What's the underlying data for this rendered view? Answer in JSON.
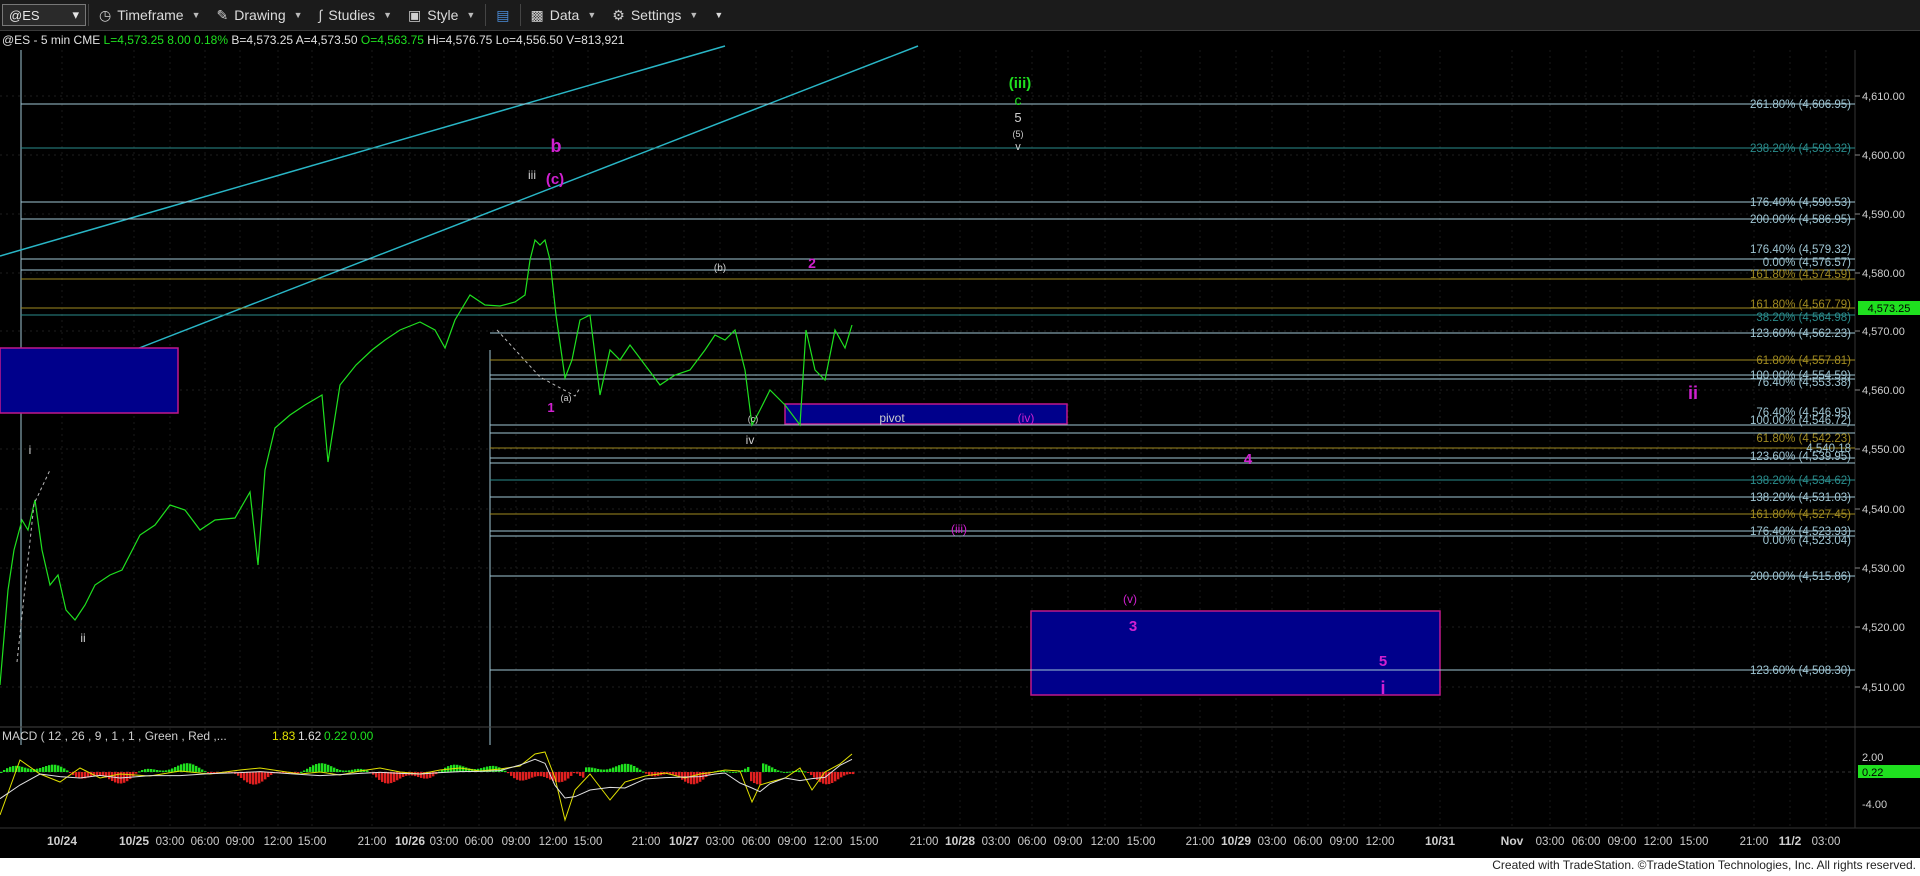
{
  "toolbar": {
    "symbol": "@ES",
    "timeframe": "Timeframe",
    "drawing": "Drawing",
    "studies": "Studies",
    "style": "Style",
    "data": "Data",
    "settings": "Settings"
  },
  "header": {
    "symbol_line": "@ES - 5 min  CME",
    "last": "L=4,573.25",
    "change": "8.00",
    "pct": "0.18%",
    "bid": "B=4,573.25",
    "ask": "A=4,573.50",
    "open": "O=4,563.75",
    "high": "Hi=4,576.75",
    "low": "Lo=4,556.50",
    "volume": "V=813,921"
  },
  "price_axis": {
    "ticks": [
      "4,610.00",
      "4,600.00",
      "4,590.00",
      "4,580.00",
      "4,570.00",
      "4,560.00",
      "4,550.00",
      "4,540.00",
      "4,530.00",
      "4,520.00",
      "4,510.00"
    ],
    "current": "4,573.25"
  },
  "time_axis": {
    "labels": [
      "10/24",
      "10/25",
      "03:00",
      "06:00",
      "09:00",
      "12:00",
      "15:00",
      "21:00",
      "10/26",
      "03:00",
      "06:00",
      "09:00",
      "12:00",
      "15:00",
      "21:00",
      "10/27",
      "03:00",
      "06:00",
      "09:00",
      "12:00",
      "15:00",
      "21:00",
      "10/28",
      "03:00",
      "06:00",
      "09:00",
      "12:00",
      "15:00",
      "21:00",
      "10/29",
      "03:00",
      "06:00",
      "09:00",
      "12:00",
      "10/31",
      "Nov",
      "03:00",
      "06:00",
      "09:00",
      "12:00",
      "15:00",
      "21:00",
      "11/2",
      "03:00"
    ]
  },
  "fib_levels": [
    {
      "label": "261.80% (4,606.95)",
      "color": "#9fc6d4"
    },
    {
      "label": "238.20% (4,599.32)",
      "color": "#2a8c8c"
    },
    {
      "label": "176.40% (4,590.53)",
      "color": "#9fc6d4"
    },
    {
      "label": "200.00% (4,586.95)",
      "color": "#9fc6d4"
    },
    {
      "label": "176.40% (4,579.32)",
      "color": "#9fc6d4"
    },
    {
      "label": "0.00% (4,576.57)",
      "color": "#9fc6d4"
    },
    {
      "label": "161.80% (4,574.59)",
      "color": "#a08a20"
    },
    {
      "label": "161.80% (4,567.79)",
      "color": "#a08a20"
    },
    {
      "label": "38.20% (4,564.98)",
      "color": "#2a8c8c"
    },
    {
      "label": "123.60% (4,562.23)",
      "color": "#9fc6d4"
    },
    {
      "label": "61.80% (4,557.81)",
      "color": "#a08a20"
    },
    {
      "label": "100.00% (4,554.59)",
      "color": "#9fc6d4"
    },
    {
      "label": "76.40% (4,553.38)",
      "color": "#9fc6d4"
    },
    {
      "label": "76.40% (4,546.95)",
      "color": "#9fc6d4"
    },
    {
      "label": "100.00% (4,546.72)",
      "color": "#9fc6d4"
    },
    {
      "label": "61.80% (4,542.23)",
      "color": "#a08a20"
    },
    {
      "label": "4,540.18",
      "color": "#9fc6d4"
    },
    {
      "label": "123.60% (4,539.95)",
      "color": "#9fc6d4"
    },
    {
      "label": "138.20% (4,534.62)",
      "color": "#2a8c8c"
    },
    {
      "label": "138.20% (4,531.03)",
      "color": "#9fc6d4"
    },
    {
      "label": "161.80% (4,527.45)",
      "color": "#a08a20"
    },
    {
      "label": "176.40% (4,523.93)",
      "color": "#9fc6d4"
    },
    {
      "label": "0.00% (4,523.04)",
      "color": "#9fc6d4"
    },
    {
      "label": "200.00% (4,515.86)",
      "color": "#9fc6d4"
    },
    {
      "label": "123.60% (4,508.30)",
      "color": "#9fc6d4"
    }
  ],
  "wave_labels": {
    "green_iii": "(iii)",
    "green_c": "c",
    "white_5": "5",
    "white_5p": "(5)",
    "white_v": "v",
    "b": "b",
    "c_paren": "(c)",
    "iii_small": "iii",
    "b_paren": "(b)",
    "two": "2",
    "one": "1",
    "a_paren": "(a)",
    "c_small": "(c)",
    "iv_small": "iv",
    "pivot": "pivot",
    "iv_paren": "(iv)",
    "four": "4",
    "iii_paren": "(iii)",
    "v_paren": "(v)",
    "three": "3",
    "five": "5",
    "i_magenta": "i",
    "ii_magenta": "ii",
    "i_small": "i",
    "ii_small": "ii"
  },
  "macd": {
    "label": "MACD ( 12 , 26 , 9 , 1 , 1 , Green , Red ,...",
    "v1": "1.83",
    "v2": "1.62",
    "v3": "0.22",
    "v4": "0.00",
    "ticks": [
      "2.00",
      "0.22",
      "-4.00"
    ]
  },
  "footer": "Created with TradeStation. ©TradeStation Technologies, Inc. All rights reserved.",
  "colors": {
    "price": "#1fe01f",
    "magenta": "#d020d0",
    "box_fill": "#00008b",
    "channel": "#29b6c6"
  }
}
